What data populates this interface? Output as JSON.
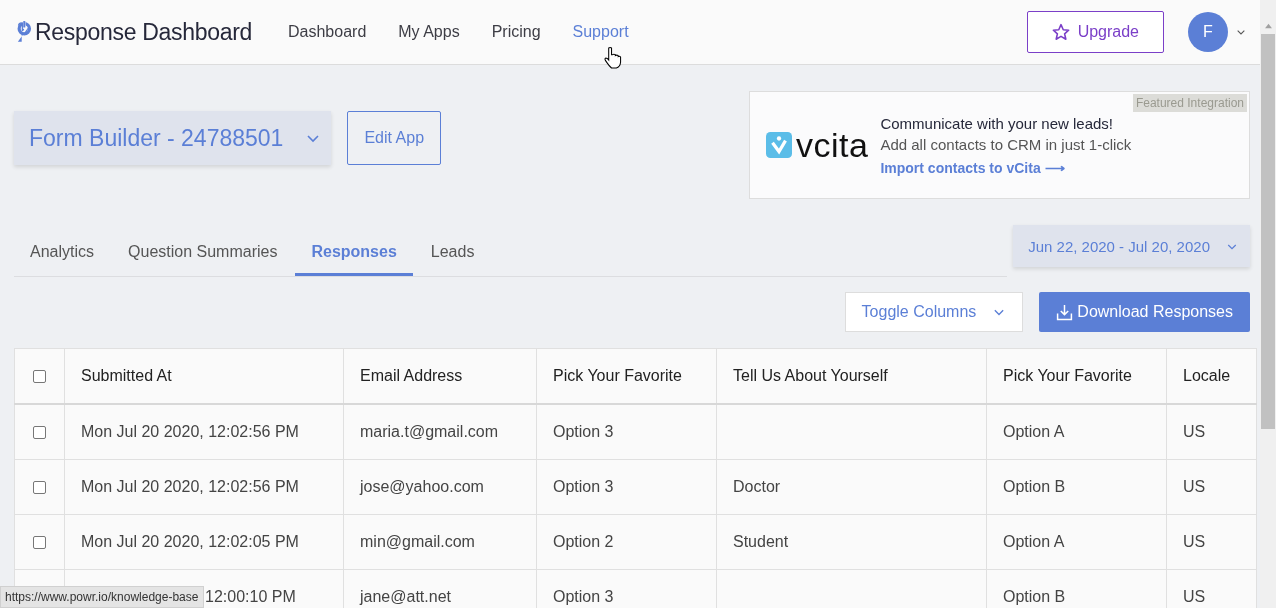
{
  "header": {
    "brand": "Response Dashboard",
    "nav": [
      {
        "label": "Dashboard",
        "selected": false
      },
      {
        "label": "My Apps",
        "selected": false
      },
      {
        "label": "Pricing",
        "selected": false
      },
      {
        "label": "Support",
        "selected": true
      }
    ],
    "upgrade": "Upgrade",
    "avatar": "F"
  },
  "app_selector": {
    "label": "Form Builder - 24788501"
  },
  "edit_button": "Edit App",
  "promo": {
    "badge": "Featured Integration",
    "logo_text": "vcita",
    "title": "Communicate with your new leads!",
    "text": "Add all contacts to CRM in just 1-click",
    "link": "Import contacts to vCita ⟶"
  },
  "tabs": [
    {
      "label": "Analytics",
      "selected": false
    },
    {
      "label": "Question Summaries",
      "selected": false
    },
    {
      "label": "Responses",
      "selected": true
    },
    {
      "label": "Leads",
      "selected": false
    }
  ],
  "date_range": "Jun 22, 2020 - Jul 20, 2020",
  "toggle_columns": "Toggle Columns",
  "download_button": "Download Responses",
  "table": {
    "select_all_checked": false,
    "columns": [
      "Submitted At",
      "Email Address",
      "Pick Your Favorite",
      "Tell Us About Yourself",
      "Pick Your Favorite",
      "Locale"
    ],
    "rows": [
      {
        "checked": false,
        "cells": [
          "Mon Jul 20 2020, 12:02:56 PM",
          "maria.t@gmail.com",
          "Option 3",
          "",
          "Option A",
          "US"
        ]
      },
      {
        "checked": false,
        "cells": [
          "Mon Jul 20 2020, 12:02:56 PM",
          "jose@yahoo.com",
          "Option 3",
          "Doctor",
          "Option B",
          "US"
        ]
      },
      {
        "checked": false,
        "cells": [
          "Mon Jul 20 2020, 12:02:05 PM",
          "min@gmail.com",
          "Option 2",
          "Student",
          "Option A",
          "US"
        ]
      },
      {
        "cells": [
          "12:00:10 PM",
          "jane@att.net",
          "Option 3",
          "",
          "Option B",
          "US"
        ]
      }
    ]
  },
  "status_url": "https://www.powr.io/knowledge-base"
}
